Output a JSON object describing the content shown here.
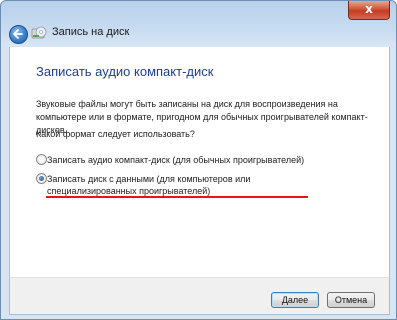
{
  "window": {
    "title": "Запись на диск",
    "close_symbol": "x"
  },
  "main": {
    "heading": "Записать аудио компакт-диск",
    "description": "Звуковые файлы могут быть записаны на диск для воспроизведения на компьютере или в формате, пригодном для обычных проигрывателей компакт-дисков.",
    "question": "Какой формат следует использовать?",
    "options": [
      {
        "label": "Записать аудио компакт-диск (для обычных проигрывателей)",
        "checked": false
      },
      {
        "label": "Записать диск с данными (для компьютеров или специализированных проигрывателей)",
        "checked": true
      }
    ]
  },
  "footer": {
    "next_label": "Далее",
    "cancel_label": "Отмена"
  },
  "icons": {
    "back": "back-arrow-icon",
    "wizard": "disc-burn-icon",
    "radio": "radio-button-icon"
  },
  "colors": {
    "heading": "#1e3f8f",
    "annotation": "#e01818"
  }
}
